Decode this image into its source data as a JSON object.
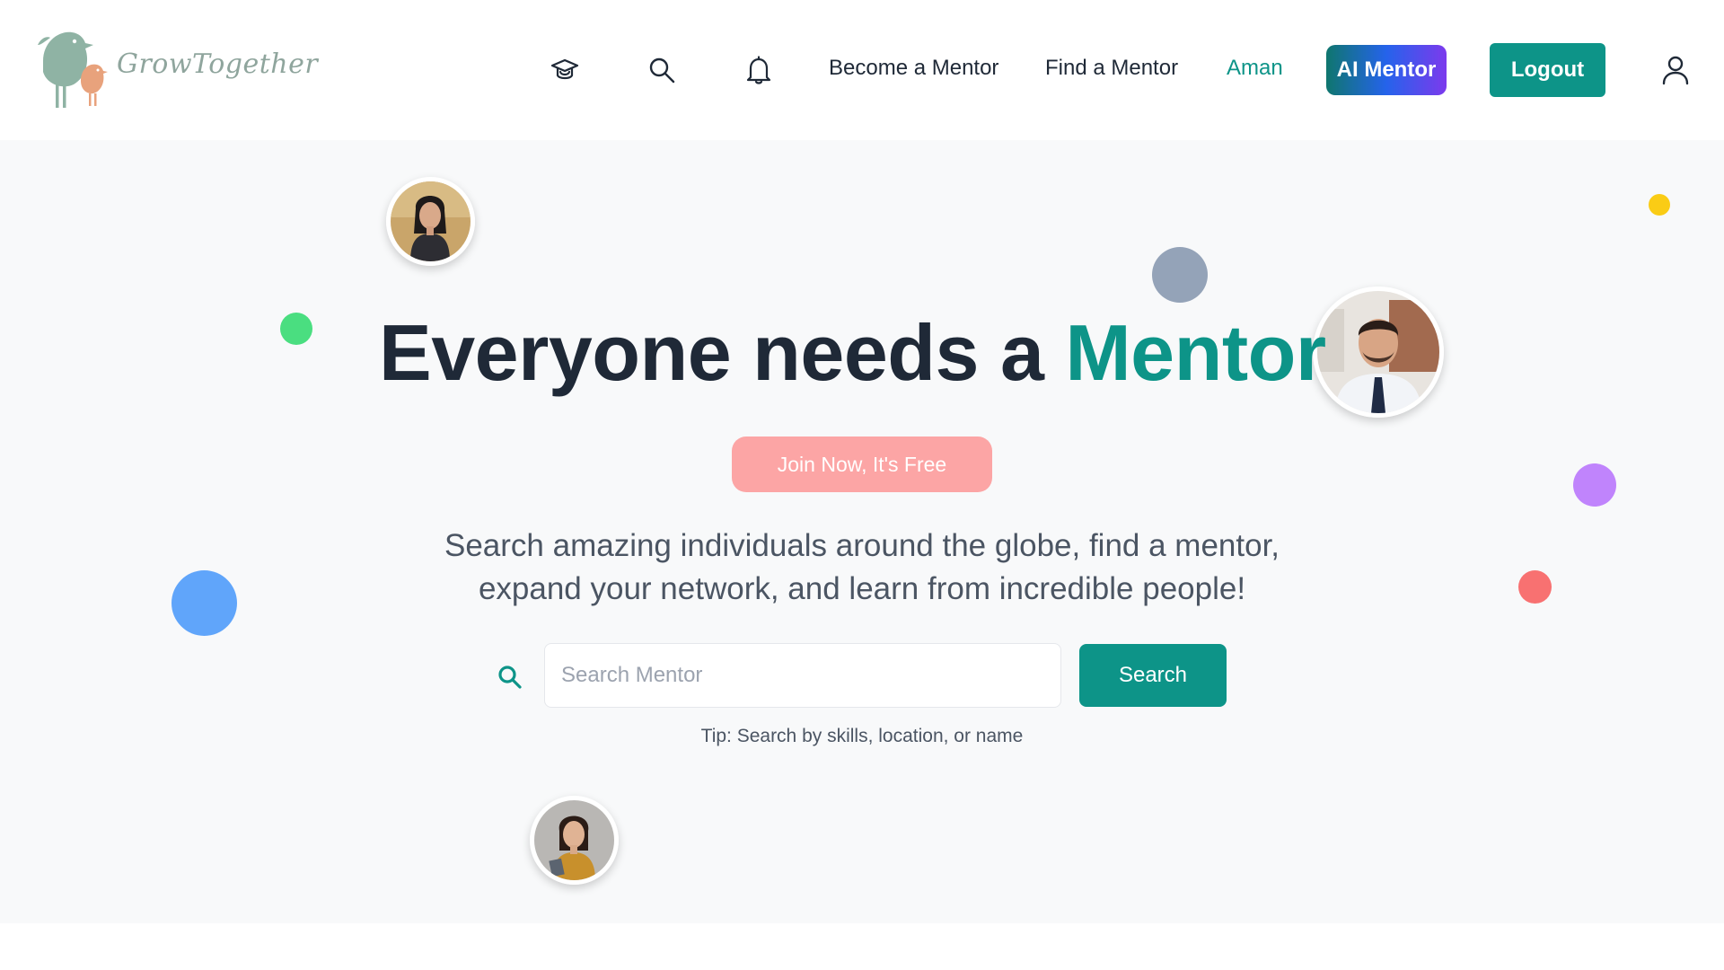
{
  "header": {
    "logo_text": "GrowTogether",
    "nav": {
      "become_mentor": "Become a Mentor",
      "find_mentor": "Find a Mentor",
      "user_name": "Aman",
      "ai_mentor": "AI Mentor",
      "logout": "Logout"
    },
    "icons": [
      "graduation-cap-icon",
      "search-icon",
      "bell-icon",
      "user-icon"
    ]
  },
  "hero": {
    "headline_prefix": "Everyone needs a ",
    "headline_accent": "Mentor",
    "join_button": "Join Now, It's Free",
    "subtitle_line1": "Search amazing individuals around the globe, find a mentor,",
    "subtitle_line2": "expand your network, and learn from incredible people!",
    "search": {
      "placeholder": "Search Mentor",
      "value": "",
      "button": "Search"
    },
    "tip": "Tip: Search by skills, location, or name"
  },
  "colors": {
    "brand_teal": "#0d9488",
    "text_dark": "#1f2937",
    "join_pink": "#fca5a5",
    "dot_green": "#4ade80",
    "dot_blue": "#60a5fa",
    "dot_gray": "#94a3b8",
    "dot_yellow": "#facc15",
    "dot_purple": "#c084fc",
    "dot_red": "#f87171"
  }
}
